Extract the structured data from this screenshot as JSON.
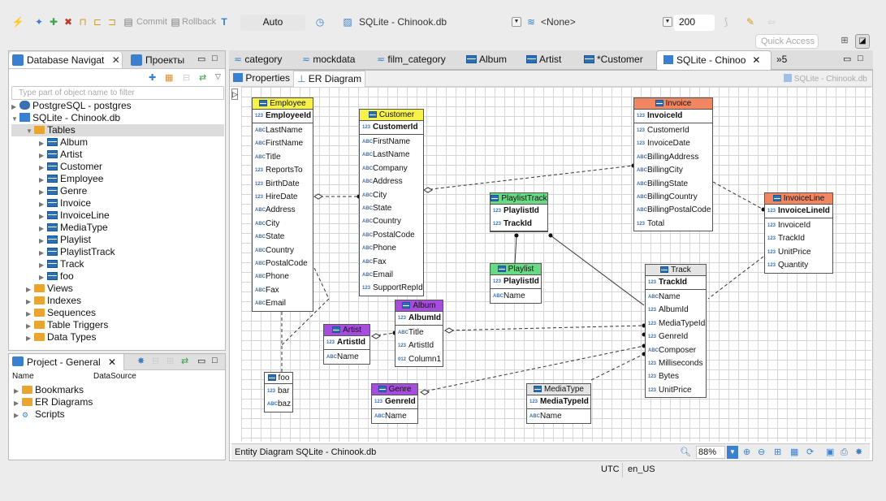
{
  "toolbar": {
    "commit": "Commit",
    "rollback": "Rollback",
    "tx_mode": "Auto",
    "connection": "SQLite - Chinook.db",
    "schema": "<None>",
    "limit": "200",
    "quick_access": "Quick Access"
  },
  "left_panel": {
    "tabs": [
      {
        "label": "Database Navigat"
      },
      {
        "label": "Проекты"
      }
    ],
    "filter_placeholder": "Type part of object name to filter",
    "tree": [
      {
        "label": "PostgreSQL - postgres"
      },
      {
        "label": "SQLite - Chinook.db"
      },
      {
        "label": "Tables"
      },
      {
        "label": "Album"
      },
      {
        "label": "Artist"
      },
      {
        "label": "Customer"
      },
      {
        "label": "Employee"
      },
      {
        "label": "Genre"
      },
      {
        "label": "Invoice"
      },
      {
        "label": "InvoiceLine"
      },
      {
        "label": "MediaType"
      },
      {
        "label": "Playlist"
      },
      {
        "label": "PlaylistTrack"
      },
      {
        "label": "Track"
      },
      {
        "label": "foo"
      },
      {
        "label": "Views"
      },
      {
        "label": "Indexes"
      },
      {
        "label": "Sequences"
      },
      {
        "label": "Table Triggers"
      },
      {
        "label": "Data Types"
      }
    ]
  },
  "project_panel": {
    "tab": "Project - General",
    "col_name": "Name",
    "col_datasource": "DataSource",
    "items": [
      {
        "label": "Bookmarks"
      },
      {
        "label": "ER Diagrams"
      },
      {
        "label": "Scripts"
      }
    ]
  },
  "editor_tabs": [
    {
      "label": "category"
    },
    {
      "label": "mockdata"
    },
    {
      "label": "film_category"
    },
    {
      "label": "Album"
    },
    {
      "label": "Artist"
    },
    {
      "label": "*Customer"
    },
    {
      "label": "SQLite - Chinoo"
    },
    {
      "label": "»5"
    }
  ],
  "sub_tabs": {
    "properties": "Properties",
    "er": "ER Diagram",
    "conn": "SQLite - Chinook.db"
  },
  "entities": [
    {
      "name": "Employee",
      "pk": "EmployeeId",
      "cols": [
        [
          "ABC",
          "LastName"
        ],
        [
          "ABC",
          "FirstName"
        ],
        [
          "ABC",
          "Title"
        ],
        [
          "123",
          "ReportsTo"
        ],
        [
          "123",
          "BirthDate"
        ],
        [
          "123",
          "HireDate"
        ],
        [
          "ABC",
          "Address"
        ],
        [
          "ABC",
          "City"
        ],
        [
          "ABC",
          "State"
        ],
        [
          "ABC",
          "Country"
        ],
        [
          "ABC",
          "PostalCode"
        ],
        [
          "ABC",
          "Phone"
        ],
        [
          "ABC",
          "Fax"
        ],
        [
          "ABC",
          "Email"
        ]
      ],
      "color": "#f6f24a"
    },
    {
      "name": "Customer",
      "pk": "CustomerId",
      "cols": [
        [
          "ABC",
          "FirstName"
        ],
        [
          "ABC",
          "LastName"
        ],
        [
          "ABC",
          "Company"
        ],
        [
          "ABC",
          "Address"
        ],
        [
          "ABC",
          "City"
        ],
        [
          "ABC",
          "State"
        ],
        [
          "ABC",
          "Country"
        ],
        [
          "ABC",
          "PostalCode"
        ],
        [
          "ABC",
          "Phone"
        ],
        [
          "ABC",
          "Fax"
        ],
        [
          "ABC",
          "Email"
        ],
        [
          "123",
          "SupportRepId"
        ]
      ],
      "color": "#f6f24a"
    },
    {
      "name": "Invoice",
      "pk": "InvoiceId",
      "cols": [
        [
          "123",
          "CustomerId"
        ],
        [
          "123",
          "InvoiceDate"
        ],
        [
          "ABC",
          "BillingAddress"
        ],
        [
          "ABC",
          "BillingCity"
        ],
        [
          "ABC",
          "BillingState"
        ],
        [
          "ABC",
          "BillingCountry"
        ],
        [
          "ABC",
          "BillingPostalCode"
        ],
        [
          "123",
          "Total"
        ]
      ],
      "color": "#f08662"
    },
    {
      "name": "InvoiceLine",
      "pk": "InvoiceLineId",
      "cols": [
        [
          "123",
          "InvoiceId"
        ],
        [
          "123",
          "TrackId"
        ],
        [
          "123",
          "UnitPrice"
        ],
        [
          "123",
          "Quantity"
        ]
      ],
      "color": "#f08662"
    },
    {
      "name": "PlaylistTrack",
      "pk": "PlaylistId",
      "pk2": "TrackId",
      "cols": [],
      "color": "#69d983"
    },
    {
      "name": "Playlist",
      "pk": "PlaylistId",
      "cols": [
        [
          "ABC",
          "Name"
        ]
      ],
      "color": "#69d983"
    },
    {
      "name": "Track",
      "pk": "TrackId",
      "cols": [
        [
          "ABC",
          "Name"
        ],
        [
          "123",
          "AlbumId"
        ],
        [
          "123",
          "MediaTypeId"
        ],
        [
          "123",
          "GenreId"
        ],
        [
          "ABC",
          "Composer"
        ],
        [
          "123",
          "Milliseconds"
        ],
        [
          "123",
          "Bytes"
        ],
        [
          "123",
          "UnitPrice"
        ]
      ],
      "color": "#e4e4e4"
    },
    {
      "name": "Album",
      "pk": "AlbumId",
      "cols": [
        [
          "ABC",
          "Title"
        ],
        [
          "123",
          "ArtistId"
        ],
        [
          "012",
          "Column1"
        ]
      ],
      "color": "#a64ddd"
    },
    {
      "name": "Artist",
      "pk": "ArtistId",
      "cols": [
        [
          "ABC",
          "Name"
        ]
      ],
      "color": "#a64ddd"
    },
    {
      "name": "foo",
      "pk": "",
      "cols": [
        [
          "123",
          "bar"
        ],
        [
          "ABC",
          "baz"
        ]
      ],
      "color": "#ffffff"
    },
    {
      "name": "Genre",
      "pk": "GenreId",
      "cols": [
        [
          "ABC",
          "Name"
        ]
      ],
      "color": "#a64ddd"
    },
    {
      "name": "MediaType",
      "pk": "MediaTypeId",
      "cols": [
        [
          "ABC",
          "Name"
        ]
      ],
      "color": "#e4e4e4"
    }
  ],
  "er_status": {
    "label": "Entity Diagram SQLite - Chinook.db",
    "zoom": "88%"
  },
  "statusbar": {
    "tz": "UTC",
    "locale": "en_US"
  }
}
